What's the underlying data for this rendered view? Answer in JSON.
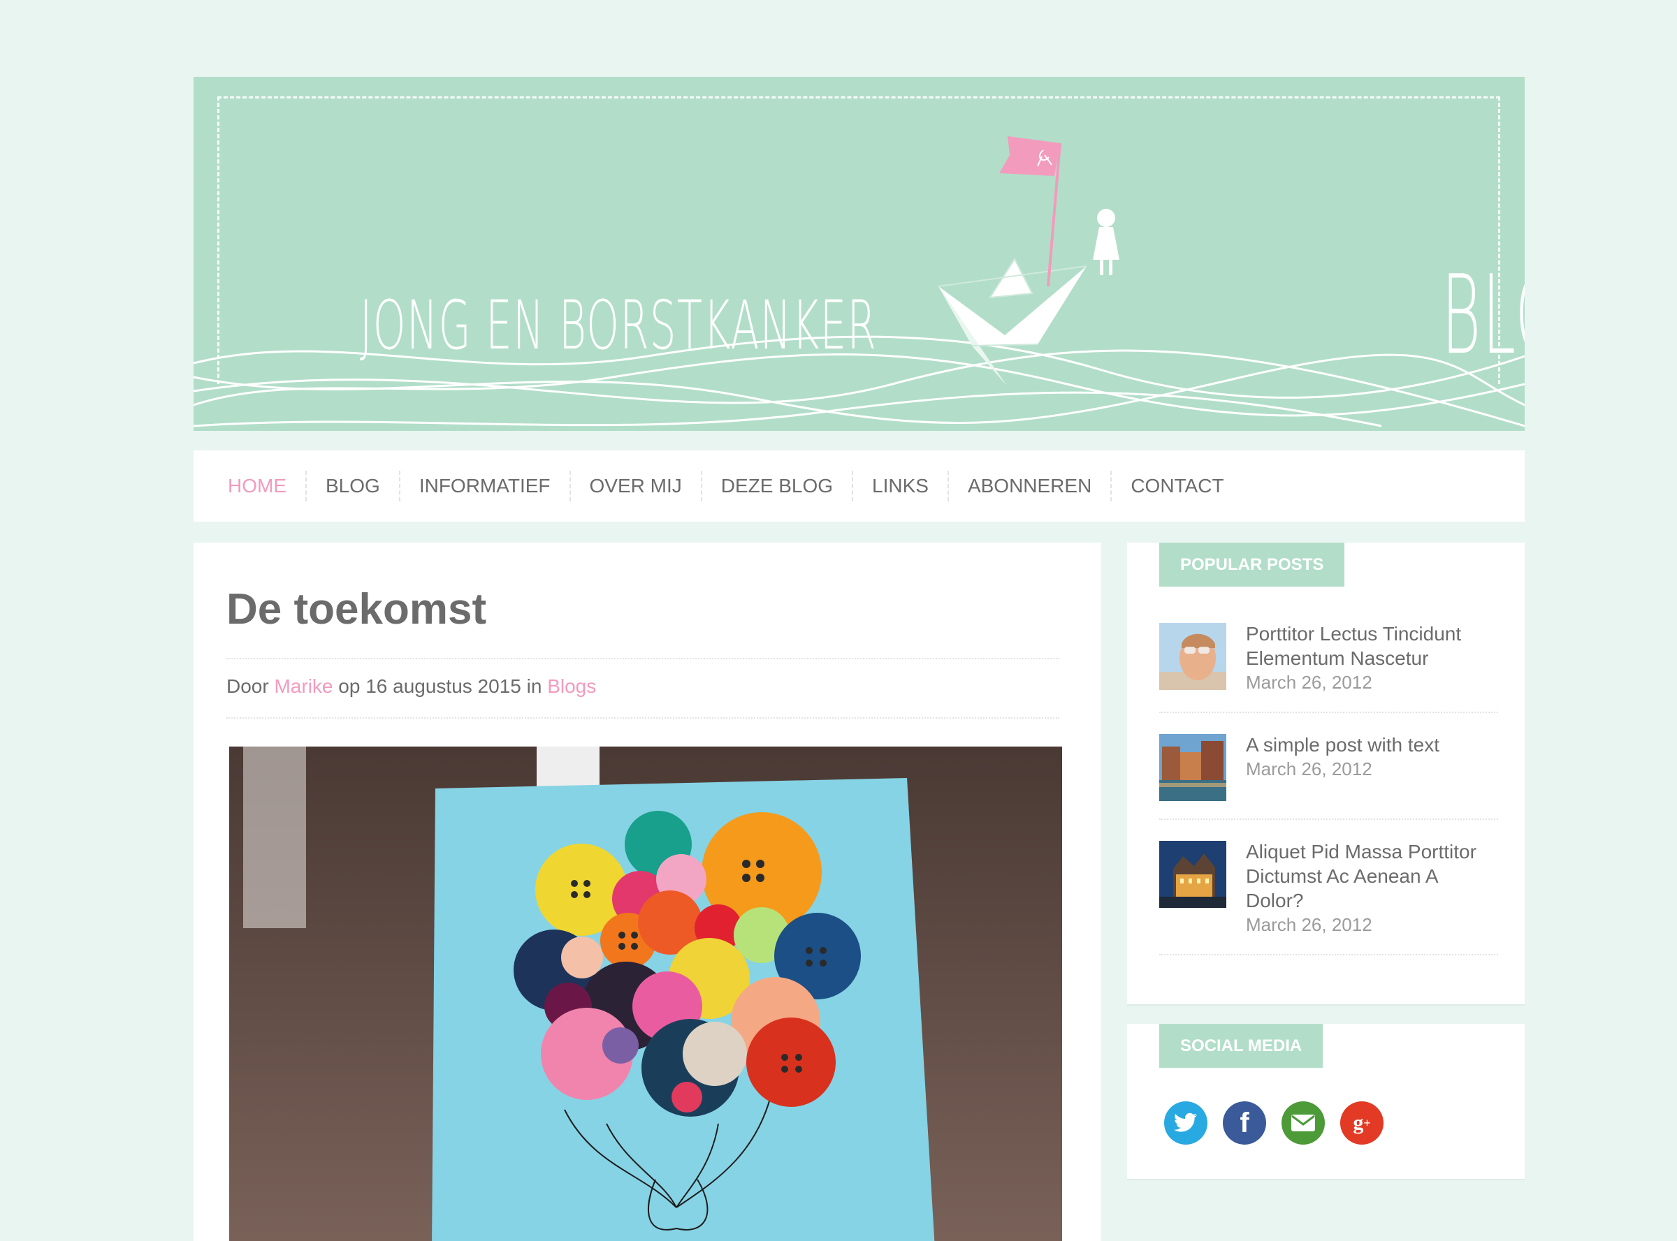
{
  "header": {
    "site_title": "JONG EN BORSTKANKER",
    "blog_label": "BLOG"
  },
  "nav": {
    "items": [
      {
        "label": "HOME",
        "active": true
      },
      {
        "label": "BLOG"
      },
      {
        "label": "INFORMATIEF"
      },
      {
        "label": "OVER MIJ"
      },
      {
        "label": "DEZE BLOG"
      },
      {
        "label": "LINKS"
      },
      {
        "label": "ABONNEREN"
      },
      {
        "label": "CONTACT"
      }
    ]
  },
  "post": {
    "title": "De toekomst",
    "meta_prefix": "Door",
    "author": "Marike",
    "meta_mid": "op 16 augustus 2015 in",
    "category": "Blogs"
  },
  "sidebar": {
    "popular": {
      "title": "POPULAR POSTS",
      "items": [
        {
          "title": "Porttitor Lectus Tincidunt Elementum Nascetur",
          "date": "March 26, 2012"
        },
        {
          "title": "A simple post with text",
          "date": "March 26, 2012"
        },
        {
          "title": "Aliquet Pid Massa Porttitor Dictumst Ac Aenean A Dolor?",
          "date": "March 26, 2012"
        }
      ]
    },
    "social": {
      "title": "SOCIAL MEDIA",
      "icons": [
        "twitter-icon",
        "facebook-icon",
        "email-icon",
        "google-plus-icon"
      ]
    }
  },
  "colors": {
    "accent": "#f29bbd",
    "mint": "#b2dec9",
    "background": "#e9f5f0",
    "text": "#6b6b6b"
  }
}
